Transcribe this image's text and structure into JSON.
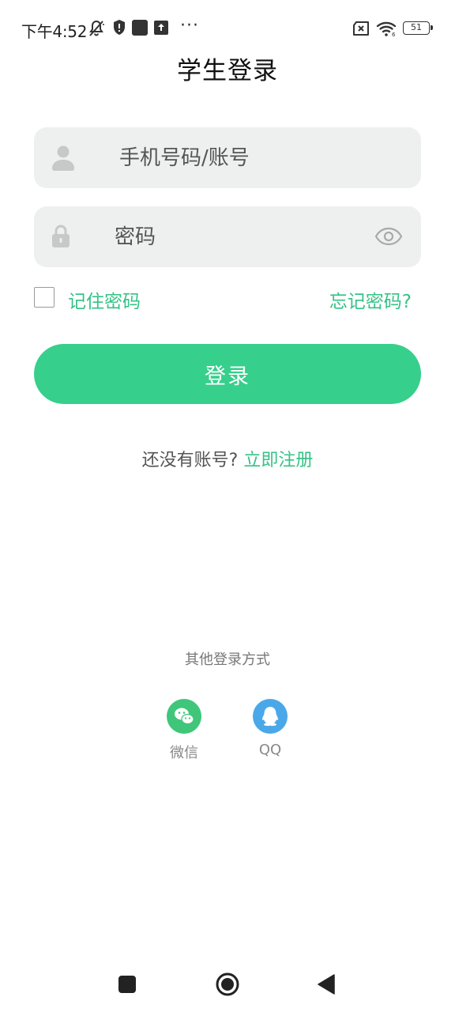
{
  "status_bar": {
    "time": "下午4:52",
    "more": "···",
    "battery": "51",
    "icons": [
      "mute-bell-icon",
      "shield-icon",
      "app-square-icon",
      "upload-icon",
      "sim-x-icon",
      "wifi-icon",
      "battery-icon"
    ]
  },
  "header": {
    "title": "学生登录"
  },
  "login_form": {
    "account_placeholder": "手机号码/账号",
    "password_placeholder": "密码",
    "remember_label": "记住密码",
    "forgot_label": "忘记密码?",
    "login_button": "登录",
    "register_prompt": "还没有账号?",
    "register_link": "立即注册"
  },
  "other_login": {
    "title": "其他登录方式",
    "methods": [
      {
        "label": "微信",
        "icon": "wechat-icon"
      },
      {
        "label": "QQ",
        "icon": "qq-icon"
      }
    ]
  },
  "nav_bar": {
    "icons": [
      "recents-icon",
      "home-icon",
      "back-icon"
    ]
  },
  "colors": {
    "accent": "#37cf8c",
    "accent_text": "#35c286",
    "field_bg": "#eef0ef",
    "wechat": "#3fc67a",
    "qq": "#4aa8e8"
  }
}
